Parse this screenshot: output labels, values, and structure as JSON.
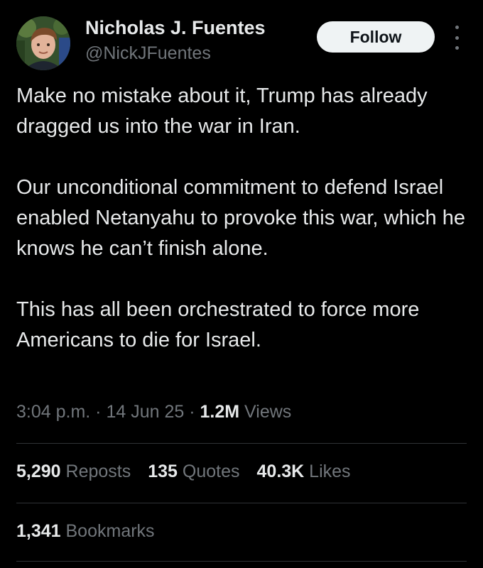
{
  "author": {
    "name": "Nicholas J. Fuentes",
    "handle": "@NickJFuentes",
    "avatar_icon": "profile-photo"
  },
  "header": {
    "follow_label": "Follow",
    "more_icon": "more-vertical-icon"
  },
  "tweet": {
    "paragraphs": [
      "Make no mistake about it, Trump has already dragged us into the war in Iran.",
      "Our unconditional commitment to defend Israel enabled Netanyahu to provoke this war, which he knows he can’t finish alone.",
      "This has all been orchestrated to force more Americans to die for Israel."
    ]
  },
  "meta": {
    "time": "3:04 p.m.",
    "separator": " · ",
    "date": "14 Jun 25",
    "views_count": "1.2M",
    "views_label": " Views"
  },
  "stats": {
    "reposts_count": "5,290",
    "reposts_label": " Reposts",
    "quotes_count": "135",
    "quotes_label": " Quotes",
    "likes_count": "40.3K",
    "likes_label": " Likes",
    "bookmarks_count": "1,341",
    "bookmarks_label": " Bookmarks"
  },
  "colors": {
    "background": "#000000",
    "text_primary": "#e7e9ea",
    "text_secondary": "#71767b",
    "divider": "#2f3336",
    "follow_bg": "#eff3f4"
  }
}
